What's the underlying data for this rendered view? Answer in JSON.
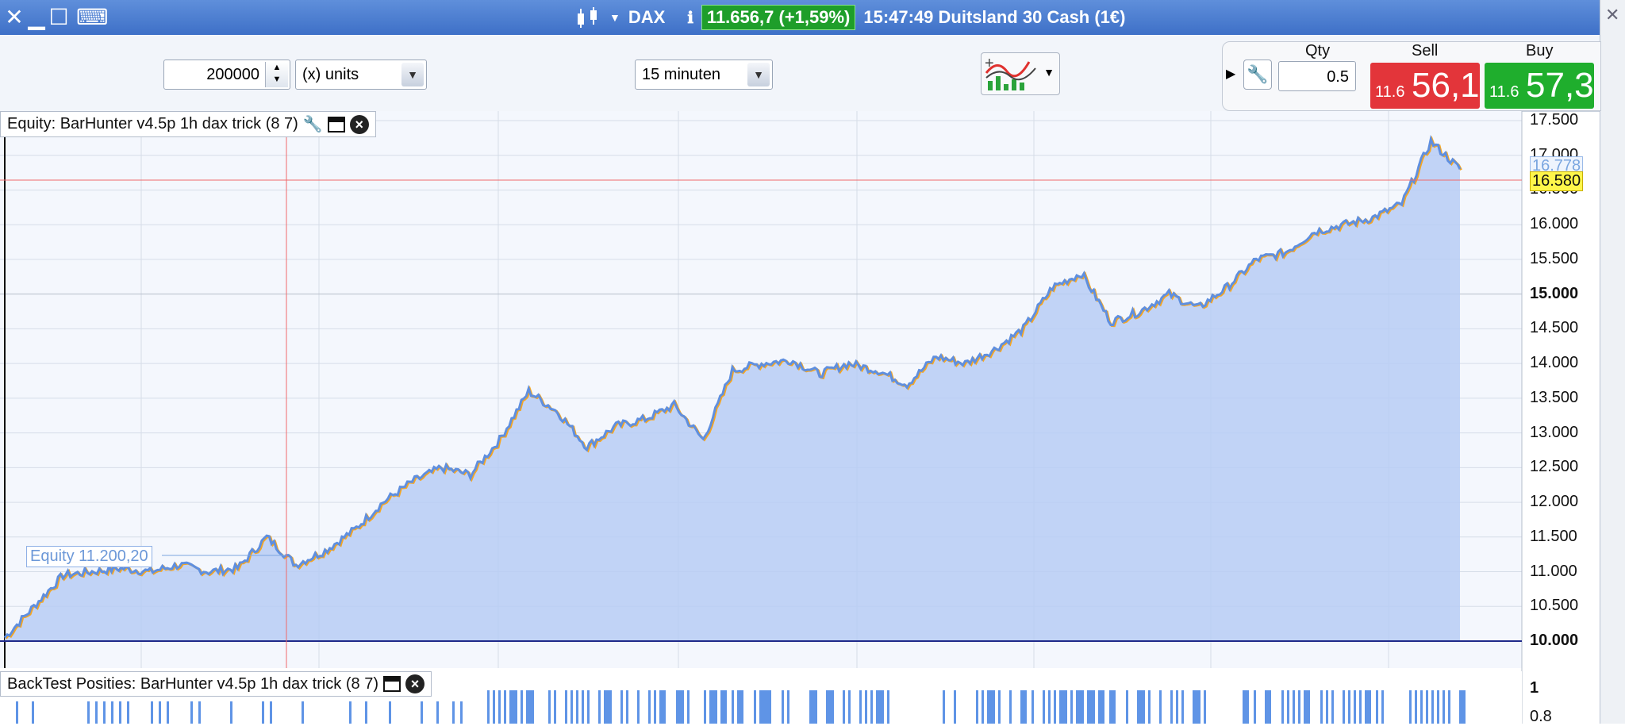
{
  "titlebar": {
    "instrument": "DAX",
    "price_change": "11.656,7 (+1,59%)",
    "time_and_name": "15:47:49 Duitsland 30 Cash (1€)"
  },
  "toolbar": {
    "amount": "200000",
    "units_select": "(x) units",
    "interval_select": "15 minuten"
  },
  "trade": {
    "qty_label": "Qty",
    "qty_value": "0.5",
    "sell_label": "Sell",
    "buy_label": "Buy",
    "sell_small": "11.6",
    "sell_big": "56,1",
    "buy_small": "11.6",
    "buy_big": "57,3"
  },
  "panels": {
    "equity_title": "Equity: BarHunter v4.5p 1h dax trick (8 7)",
    "equity_tag": "Equity  11.200,20",
    "backtest_title": "BackTest Posities: BarHunter v4.5p 1h dax trick (8 7)"
  },
  "axis": {
    "labels": [
      "17.500",
      "17.000",
      "16.500",
      "16.000",
      "15.500",
      "15.000",
      "14.500",
      "14.000",
      "13.500",
      "13.000",
      "12.500",
      "12.000",
      "11.500",
      "11.000",
      "10.500",
      "10.000"
    ],
    "current_blue": "16.778",
    "current_yellow": "16.580",
    "lower_1": "1",
    "lower_2": "0.8"
  },
  "colors": {
    "line_blue": "#5f8fdf",
    "line_orange": "#f5a623",
    "fill": "#b7cdf5",
    "accent_red": "#e3353a",
    "accent_green": "#1fae2d"
  },
  "chart_data": {
    "type": "area",
    "x": [
      0,
      2,
      4,
      6,
      8,
      10,
      12,
      14,
      16,
      18,
      20,
      22,
      24,
      26,
      28,
      30,
      32,
      34,
      36,
      38,
      40,
      42,
      44,
      46,
      48,
      50,
      52,
      54,
      56,
      58,
      60,
      62,
      64,
      66,
      68,
      70,
      72,
      74,
      76,
      78,
      80,
      82,
      84,
      86,
      88,
      90,
      92,
      94,
      96,
      98,
      100
    ],
    "series": [
      {
        "values": [
          10050,
          10500,
          10950,
          11000,
          11050,
          11000,
          11100,
          11000,
          11050,
          11500,
          11100,
          11300,
          11600,
          12000,
          12300,
          12500,
          12400,
          12900,
          13600,
          13300,
          12800,
          13100,
          13200,
          13400,
          12900,
          13900,
          14000,
          14050,
          13850,
          14000,
          13900,
          13700,
          14100,
          14000,
          14200,
          14500,
          15100,
          15300,
          14600,
          14750,
          15000,
          14800,
          15100,
          15500,
          15600,
          15900,
          16000,
          16100,
          16300,
          17200,
          16800
        ]
      }
    ],
    "ylim": [
      10000,
      17500
    ]
  }
}
